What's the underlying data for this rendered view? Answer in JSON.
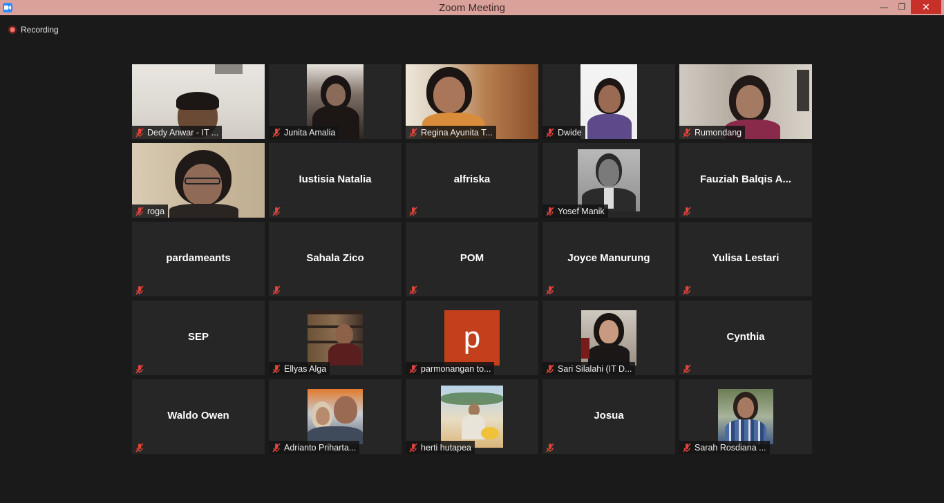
{
  "window": {
    "title": "Zoom Meeting",
    "minimize_glyph": "—",
    "maximize_glyph": "❐",
    "close_glyph": "✕"
  },
  "recording": {
    "label": "Recording"
  },
  "colors": {
    "background": "#1a1a1a",
    "tile": "#262626",
    "titlebar": "#d9a19a",
    "mute_red": "#e0443a",
    "recording_red": "#e24b3f"
  },
  "participants": [
    {
      "name": "Dedy Anwar - IT ...",
      "video": true,
      "muted": true
    },
    {
      "name": "Junita Amalia",
      "video": true,
      "muted": true
    },
    {
      "name": "Regina Ayunita T...",
      "video": true,
      "muted": true
    },
    {
      "name": "Dwide",
      "video": true,
      "muted": true
    },
    {
      "name": "Rumondang",
      "video": true,
      "muted": true
    },
    {
      "name": "roga",
      "video": true,
      "muted": true
    },
    {
      "name": "Iustisia Natalia",
      "video": false,
      "muted": true
    },
    {
      "name": "alfriska",
      "video": false,
      "muted": true
    },
    {
      "name": "Yosef Manik",
      "video": true,
      "muted": true
    },
    {
      "name": "Fauziah Balqis A...",
      "video": false,
      "muted": true
    },
    {
      "name": "pardameants",
      "video": false,
      "muted": true
    },
    {
      "name": "Sahala Zico",
      "video": false,
      "muted": true
    },
    {
      "name": "POM",
      "video": false,
      "muted": true
    },
    {
      "name": "Joyce Manurung",
      "video": false,
      "muted": true
    },
    {
      "name": "Yulisa Lestari",
      "video": false,
      "muted": true
    },
    {
      "name": "SEP",
      "video": false,
      "muted": true
    },
    {
      "name": "Ellyas Alga",
      "video": true,
      "muted": true
    },
    {
      "name": "parmonangan to...",
      "video": false,
      "avatar_letter": "p",
      "muted": true
    },
    {
      "name": "Sari Silalahi (IT D...",
      "video": true,
      "muted": true
    },
    {
      "name": "Cynthia",
      "video": false,
      "muted": true
    },
    {
      "name": "Waldo Owen",
      "video": false,
      "muted": true
    },
    {
      "name": "Adrianto Priharta...",
      "video": true,
      "muted": true
    },
    {
      "name": "herti hutapea",
      "video": true,
      "muted": true
    },
    {
      "name": "Josua",
      "video": false,
      "muted": true
    },
    {
      "name": "Sarah Rosdiana ...",
      "video": true,
      "muted": true
    }
  ]
}
